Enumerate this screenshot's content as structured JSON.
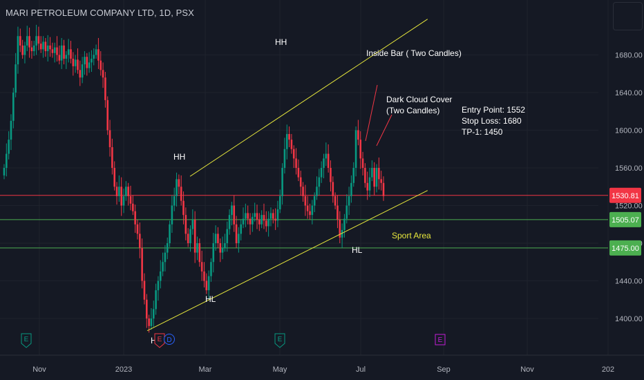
{
  "header": {
    "title": "MARI PETROLEUM COMPANY LTD, 1D, PSX"
  },
  "colors": {
    "background": "#151924",
    "grid": "#1e222d",
    "up": "#089981",
    "down": "#f23645",
    "trendline": "#e6e63c",
    "support_line": "#4caf50",
    "price_line": "#f23645",
    "axis_text": "#b2b5be"
  },
  "chart_data": {
    "type": "candlestick",
    "title": "MARI PETROLEUM COMPANY LTD, 1D, PSX",
    "interval": "1D",
    "exchange": "PSX",
    "x_ticks": [
      "Nov",
      "2023",
      "Mar",
      "May",
      "Jul",
      "Sep",
      "Nov",
      "202"
    ],
    "y_ticks": [
      1400,
      1440,
      1480,
      1520,
      1560,
      1600,
      1640,
      1680
    ],
    "y_tick_labels": [
      "1400.00",
      "1440.00",
      "1480.00",
      "1520.00",
      "1560.00",
      "1600.00",
      "1640.00",
      "1680.00"
    ],
    "ylim": [
      1382,
      1718
    ],
    "grid": true,
    "price_labels": [
      {
        "value": 1530.81,
        "label": "1530.81",
        "color": "#f23645"
      },
      {
        "value": 1505.07,
        "label": "1505.07",
        "color": "#4caf50"
      },
      {
        "value": 1475.0,
        "label": "1475.00",
        "color": "#4caf50"
      }
    ],
    "series_close": [
      1560,
      1575,
      1590,
      1610,
      1640,
      1670,
      1700,
      1690,
      1680,
      1690,
      1700,
      1688,
      1684,
      1690,
      1700,
      1692,
      1686,
      1694,
      1684,
      1690,
      1686,
      1682,
      1688,
      1680,
      1674,
      1690,
      1676,
      1680,
      1686,
      1676,
      1668,
      1675,
      1664,
      1656,
      1670,
      1678,
      1666,
      1672,
      1676,
      1680,
      1686,
      1674,
      1664,
      1656,
      1632,
      1600,
      1582,
      1560,
      1540,
      1530,
      1540,
      1520,
      1530,
      1540,
      1530,
      1522,
      1514,
      1500,
      1490,
      1475,
      1440,
      1420,
      1400,
      1392,
      1400,
      1410,
      1430,
      1440,
      1450,
      1460,
      1470,
      1480,
      1500,
      1520,
      1530,
      1548,
      1540,
      1525,
      1510,
      1490,
      1480,
      1495,
      1505,
      1470,
      1480,
      1460,
      1450,
      1440,
      1430,
      1445,
      1460,
      1480,
      1490,
      1480,
      1470,
      1475,
      1480,
      1495,
      1510,
      1520,
      1500,
      1480,
      1490,
      1500,
      1506,
      1512,
      1506,
      1500,
      1508,
      1512,
      1505,
      1500,
      1510,
      1504,
      1498,
      1506,
      1512,
      1506,
      1504,
      1516,
      1530,
      1560,
      1580,
      1596,
      1590,
      1580,
      1570,
      1560,
      1550,
      1540,
      1530,
      1520,
      1514,
      1510,
      1520,
      1530,
      1540,
      1550,
      1560,
      1570,
      1575,
      1560,
      1545,
      1530,
      1520,
      1505,
      1486,
      1494,
      1506,
      1520,
      1530,
      1544,
      1560,
      1600,
      1590,
      1570,
      1560,
      1544,
      1536,
      1550,
      1560,
      1540,
      1560,
      1548,
      1544,
      1530
    ],
    "trendlines": [
      {
        "label": "upper",
        "from": {
          "date": "2023-02-18",
          "price": 1551
        },
        "to": {
          "date": "2023-08-20",
          "price": 1718
        }
      },
      {
        "label": "lower",
        "from": {
          "date": "2023-01-18",
          "price": 1387
        },
        "to": {
          "date": "2023-08-20",
          "price": 1536
        }
      }
    ],
    "horizontal_lines": [
      {
        "price": 1530.81,
        "color": "#f23645"
      },
      {
        "price": 1505.07,
        "color": "#4caf50"
      },
      {
        "price": 1475.0,
        "color": "#4caf50"
      }
    ],
    "annotations": {
      "hh_1": "HH",
      "hh_2": "HH",
      "hl_1": "HL",
      "hl_2": "HL",
      "hl_low": "HL",
      "inside_bar": "Inside Bar ( Two Candles)",
      "dark_cloud_1": "Dark Cloud Cover",
      "dark_cloud_2": "(Two Candles)",
      "entry": "Entry Point: 1552",
      "stop": "Stop Loss: 1680",
      "tp": "TP-1: 1450",
      "sport_area": "Sport Area"
    },
    "event_markers": [
      {
        "text": "E",
        "kind": "earnings"
      },
      {
        "text": "E",
        "kind": "earnings-red"
      },
      {
        "text": "D",
        "kind": "dividend"
      },
      {
        "text": "E",
        "kind": "earnings"
      },
      {
        "text": "E",
        "kind": "earnings-purple"
      }
    ]
  }
}
